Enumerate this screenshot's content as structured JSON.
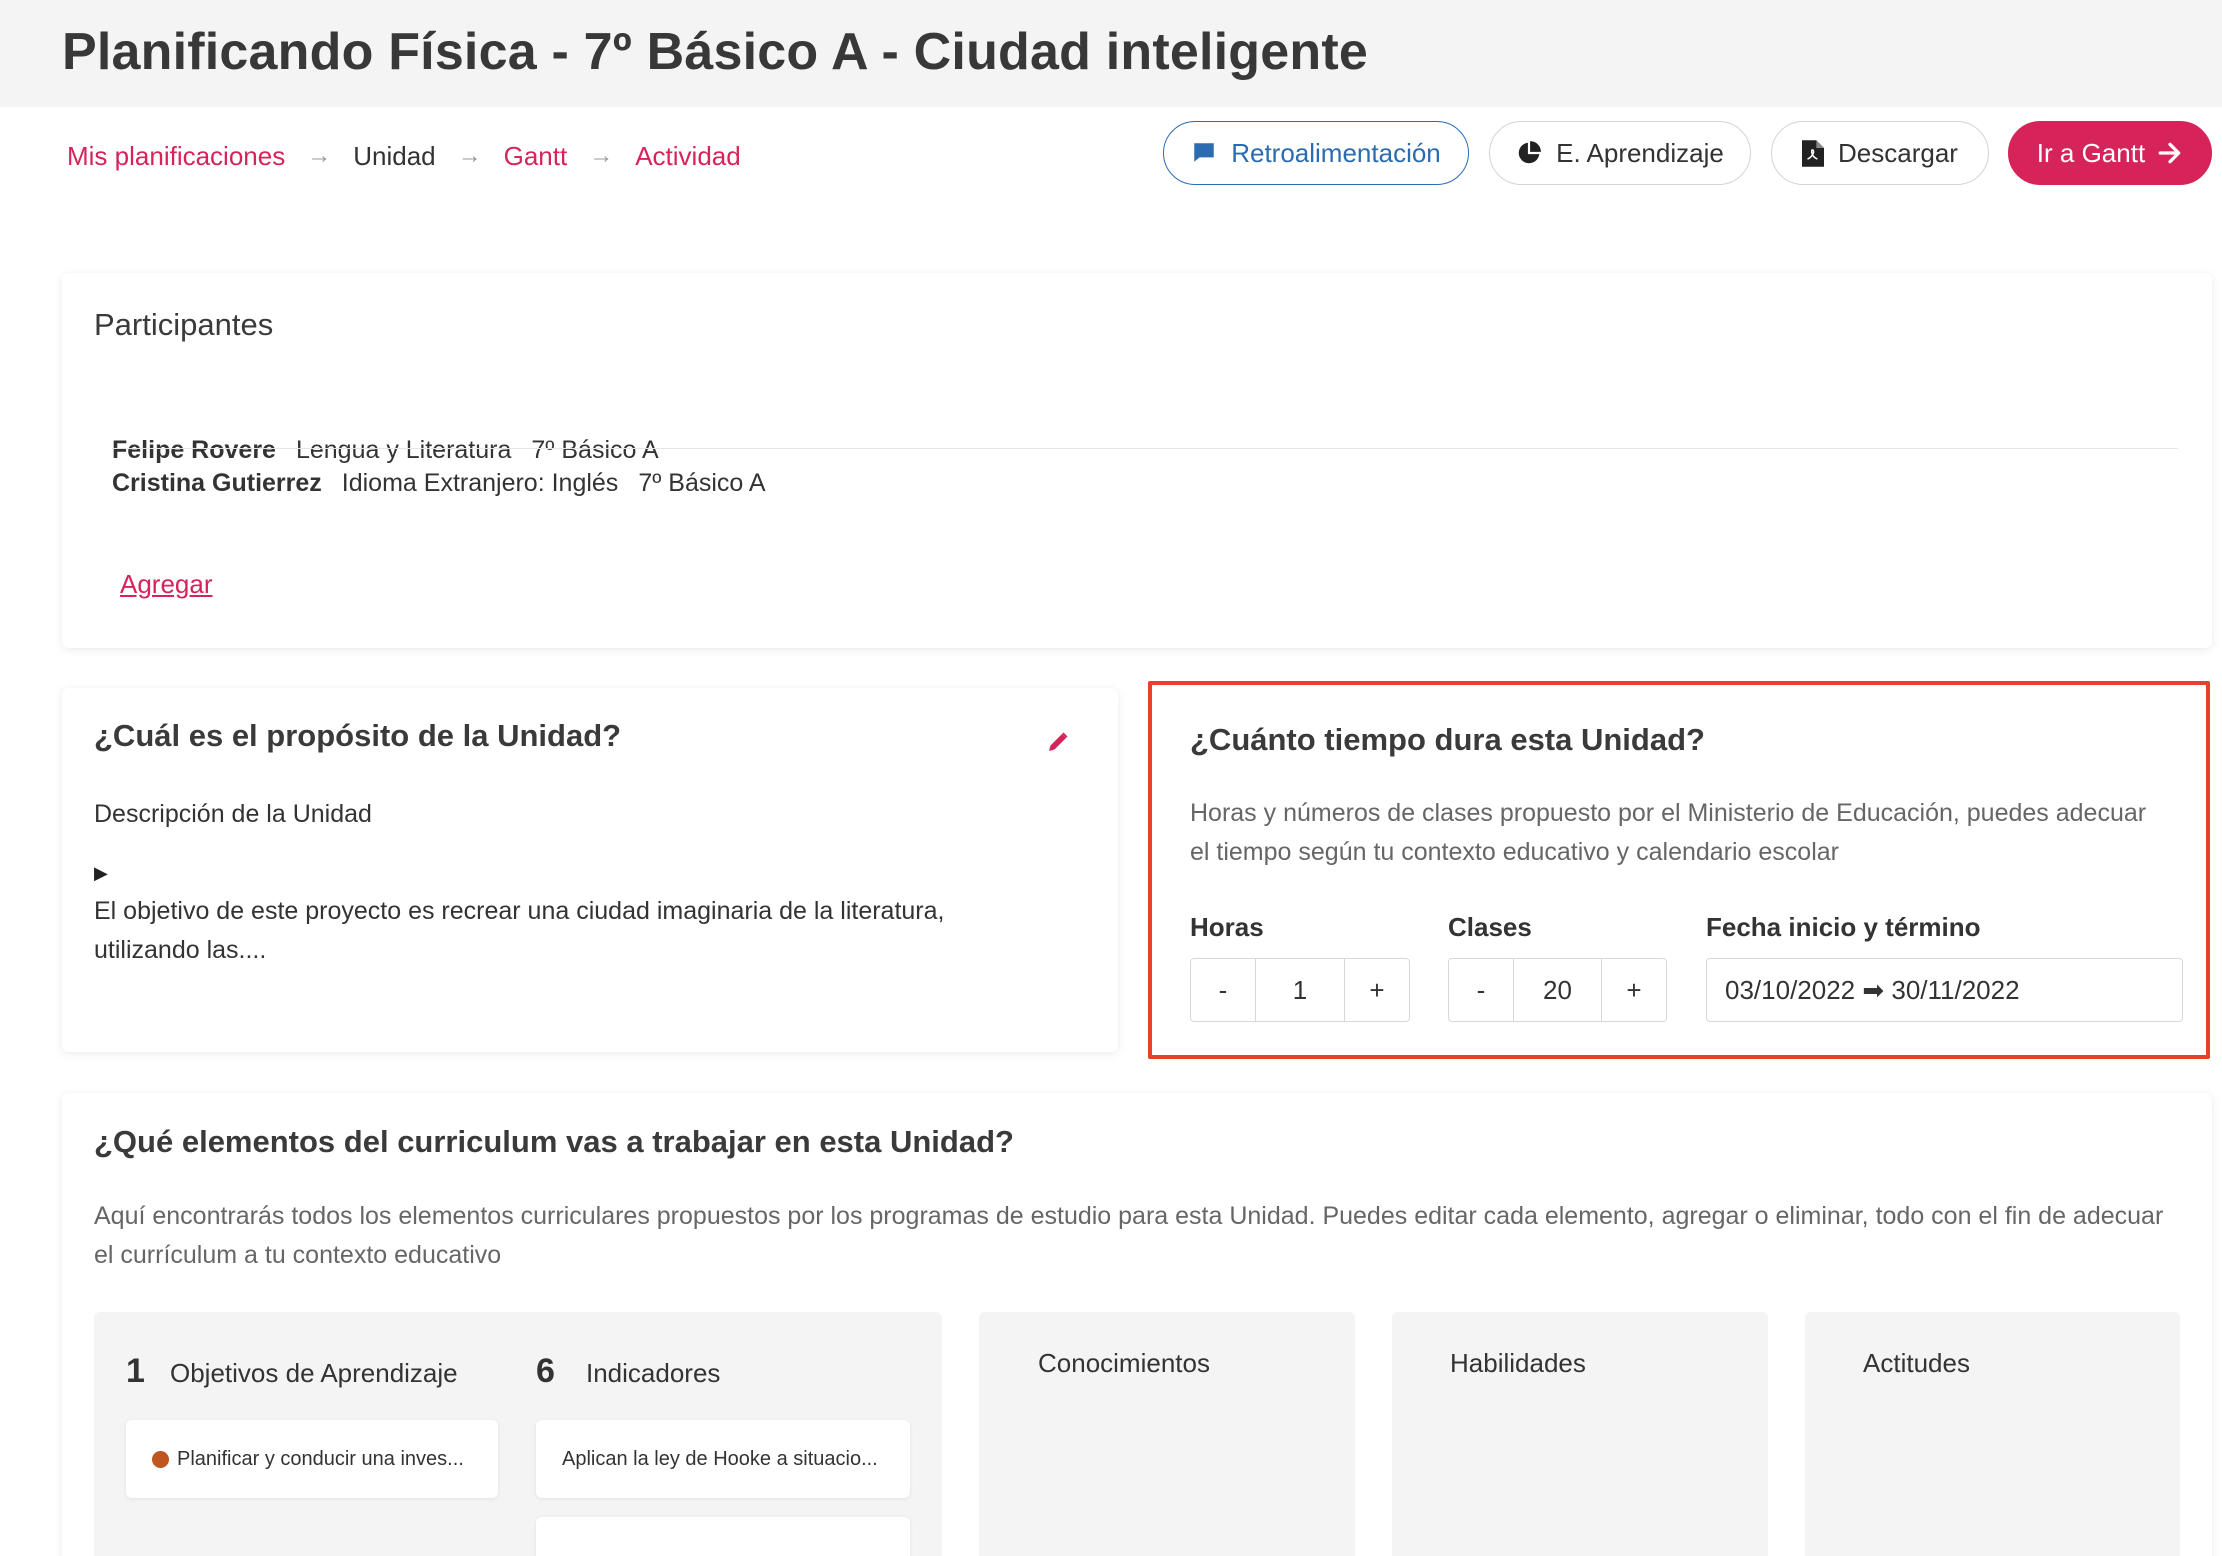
{
  "header": {
    "title": "Planificando Física - 7º Básico A - Ciudad inteligente"
  },
  "breadcrumb": {
    "items": [
      {
        "label": "Mis planificaciones",
        "type": "link"
      },
      {
        "label": "Unidad",
        "type": "current"
      },
      {
        "label": "Gantt",
        "type": "link"
      },
      {
        "label": "Actividad",
        "type": "link"
      }
    ],
    "separator": "→"
  },
  "actions": {
    "feedback_label": "Retroalimentación",
    "learning_label": "E. Aprendizaje",
    "download_label": "Descargar",
    "gantt_label": "Ir a Gantt"
  },
  "participants": {
    "heading": "Participantes",
    "rows": [
      {
        "name": "Felipe Rovere",
        "subject": "Lengua y Literatura",
        "grade": "7º Básico A"
      },
      {
        "name": "Cristina Gutierrez",
        "subject": "Idioma Extranjero: Inglés",
        "grade": "7º Básico A"
      }
    ],
    "add_label": "Agregar"
  },
  "purpose": {
    "heading": "¿Cuál es el propósito de la Unidad?",
    "description_label": "Descripción de la Unidad",
    "toggle_glyph": "▶",
    "text": "El objetivo de este proyecto es recrear una ciudad imaginaria de la literatura, utilizando las...."
  },
  "duration": {
    "heading": "¿Cuánto tiempo dura esta Unidad?",
    "help": "Horas y números de clases propuesto por el Ministerio de Educación, puedes adecuar el tiempo según tu contexto educativo y calendario escolar",
    "hours_label": "Horas",
    "hours_value": "1",
    "classes_label": "Clases",
    "classes_value": "20",
    "dates_label": "Fecha inicio y término",
    "dates_value": "03/10/2022 ➡ 30/11/2022",
    "minus": "-",
    "plus": "+"
  },
  "curriculum": {
    "heading": "¿Qué elementos del curriculum vas a trabajar en esta Unidad?",
    "help": "Aquí encontrarás todos los elementos curriculares propuestos por los programas de estudio para esta Unidad. Puedes editar cada elemento, agregar o eliminar, todo con el fin de adecuar el currículum a tu contexto educativo",
    "objectives": {
      "count": "1",
      "label": "Objetivos de Aprendizaje",
      "items": [
        "Planificar y conducir una inves..."
      ]
    },
    "indicators": {
      "count": "6",
      "label": "Indicadores",
      "items": [
        "Aplican la ley de Hooke a situacio..."
      ]
    },
    "knowledge_label": "Conocimientos",
    "skills_label": "Habilidades",
    "attitudes_label": "Actitudes"
  },
  "colors": {
    "accent": "#d6245a",
    "feedback": "#2b6cb0",
    "highlight": "#e8402a",
    "objective_dot": "#c0561f"
  },
  "icons": {
    "feedback": "chat-bubble-icon",
    "learning": "pie-chart-icon",
    "download": "pdf-file-icon",
    "gantt": "arrow-right-icon",
    "edit": "pencil-icon"
  }
}
